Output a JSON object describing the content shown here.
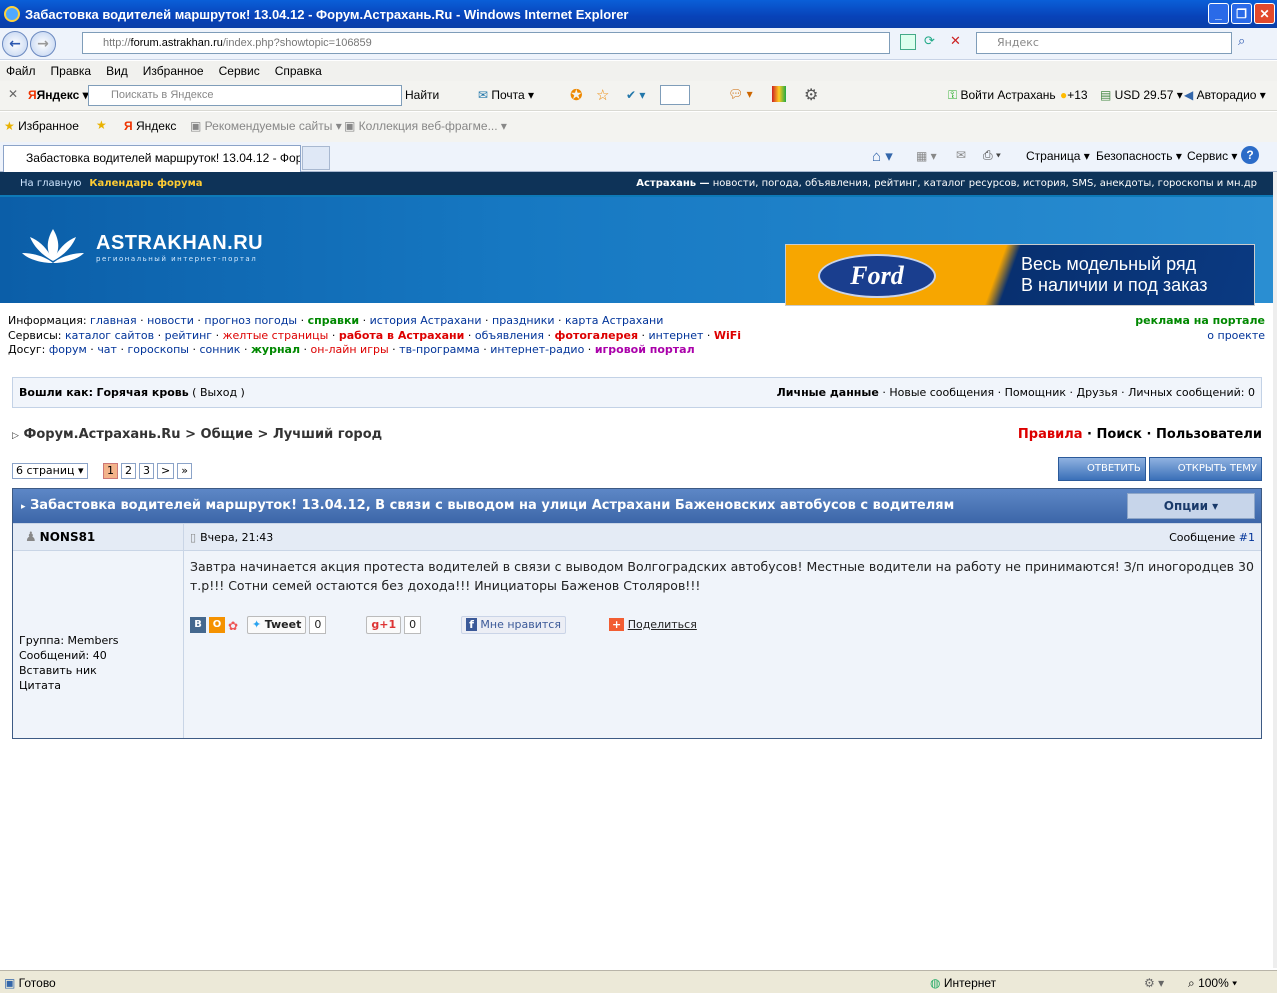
{
  "window": {
    "title": "Забастовка водителей маршруток! 13.04.12 - Форум.Астрахань.Ru - Windows Internet Explorer"
  },
  "address": {
    "prefix": "http://",
    "host": "forum.astrakhan.ru",
    "path": "/index.php?showtopic=106859",
    "search_placeholder": "Яндекс"
  },
  "menu": [
    "Файл",
    "Правка",
    "Вид",
    "Избранное",
    "Сервис",
    "Справка"
  ],
  "yandex_bar": {
    "logo": "Яндекс",
    "placeholder": "Поискать в Яндексе",
    "find": "Найти",
    "mail": "Почта",
    "login": "Войти Астрахань",
    "temp": "+13",
    "usd": "USD 29.57",
    "radio": "Авторадио"
  },
  "fav_bar": {
    "favorites": "Избранное",
    "yandex": "Яндекс",
    "recommended": "Рекомендуемые сайты",
    "gallery": "Коллекция веб-фрагме..."
  },
  "tab": {
    "title": "Забастовка водителей маршруток! 13.04.12 - Фор...",
    "page": "Страница",
    "safety": "Безопасность",
    "service": "Сервис"
  },
  "topstrip": {
    "home": "На главную",
    "calendar": "Календарь форума",
    "city": "Астрахань —",
    "tagline": "новости, погода, объявления, рейтинг, каталог ресурсов, история, SMS, анекдоты, гороскопы и мн.др"
  },
  "logo": {
    "name": "ASTRAKHAN.RU",
    "sub": "региональный интернет-портал"
  },
  "ad": {
    "brand": "Ford",
    "line1": "Весь модельный ряд",
    "line2": "В наличии и под заказ"
  },
  "links": {
    "info_label": "Информация:",
    "info": [
      "главная",
      "новости",
      "прогноз погоды",
      "справки",
      "история Астрахани",
      "праздники",
      "карта Астрахани"
    ],
    "svc_label": "Сервисы:",
    "svc": [
      "каталог сайтов",
      "рейтинг",
      "желтые страницы",
      "работа в Астрахани",
      "объявления",
      "фотогалерея",
      "интернет",
      "WiFi"
    ],
    "fun_label": "Досуг:",
    "fun": [
      "форум",
      "чат",
      "гороскопы",
      "сонник",
      "журнал",
      "он-лайн игры",
      "тв-программа",
      "интернет-радио",
      "игровой портал"
    ],
    "ads": "реклама на портале",
    "about": "о проекте"
  },
  "login": {
    "label": "Вошли как:",
    "user": "Горячая кровь",
    "logout": "Выход",
    "personal": "Личные данные",
    "new_msgs": "Новые сообщения",
    "helper": "Помощник",
    "friends": "Друзья",
    "pm": "Личных сообщений: 0"
  },
  "breadcrumb": {
    "forum": "Форум.Астрахань.Ru",
    "sep": ">",
    "general": "Общие",
    "topic": "Лучший город"
  },
  "toplinks": {
    "rules": "Правила",
    "search": "Поиск",
    "users": "Пользователи"
  },
  "pager": {
    "pages": "6 страниц",
    "p1": "1",
    "p2": "2",
    "p3": "3",
    "next": ">",
    "last": "»"
  },
  "buttons": {
    "reply": "ОТВЕТИТЬ",
    "new_topic": "ОТКРЫТЬ ТЕМУ"
  },
  "post": {
    "title": "Забастовка водителей маршруток! 13.04.12, В связи с выводом на улици Астрахани Баженовских автобусов с водителям",
    "options": "Опции",
    "author": "NONS81",
    "date": "Вчера, 21:43",
    "msg_label": "Сообщение",
    "msg_num": "#1",
    "text": "Завтра начинается акция протеста водителей в связи с выводом Волгоградских автобусов! Местные водители на работу не принимаются! З/п иногородцев 30 т.р!!! Сотни семей остаются без дохода!!! Инициаторы Баженов Столяров!!!",
    "group": "Группа: Members",
    "count": "Сообщений: 40",
    "insert_nick": "Вставить ник",
    "quote": "Цитата",
    "tweet": "Tweet",
    "tweet_count": "0",
    "gplus": "+1",
    "gplus_count": "0",
    "like": "Мне нравится",
    "share": "Поделиться"
  },
  "status": {
    "ready": "Готово",
    "zone": "Интернет",
    "zoom": "100%"
  }
}
